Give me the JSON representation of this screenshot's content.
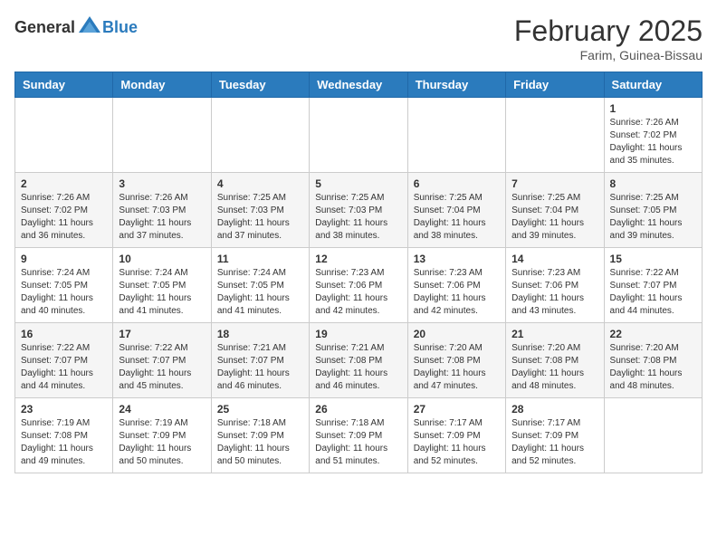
{
  "header": {
    "logo": {
      "general": "General",
      "blue": "Blue"
    },
    "title": "February 2025",
    "location": "Farim, Guinea-Bissau"
  },
  "calendar": {
    "days_of_week": [
      "Sunday",
      "Monday",
      "Tuesday",
      "Wednesday",
      "Thursday",
      "Friday",
      "Saturday"
    ],
    "weeks": [
      [
        {
          "day": "",
          "info": ""
        },
        {
          "day": "",
          "info": ""
        },
        {
          "day": "",
          "info": ""
        },
        {
          "day": "",
          "info": ""
        },
        {
          "day": "",
          "info": ""
        },
        {
          "day": "",
          "info": ""
        },
        {
          "day": "1",
          "info": "Sunrise: 7:26 AM\nSunset: 7:02 PM\nDaylight: 11 hours\nand 35 minutes."
        }
      ],
      [
        {
          "day": "2",
          "info": "Sunrise: 7:26 AM\nSunset: 7:02 PM\nDaylight: 11 hours\nand 36 minutes."
        },
        {
          "day": "3",
          "info": "Sunrise: 7:26 AM\nSunset: 7:03 PM\nDaylight: 11 hours\nand 37 minutes."
        },
        {
          "day": "4",
          "info": "Sunrise: 7:25 AM\nSunset: 7:03 PM\nDaylight: 11 hours\nand 37 minutes."
        },
        {
          "day": "5",
          "info": "Sunrise: 7:25 AM\nSunset: 7:03 PM\nDaylight: 11 hours\nand 38 minutes."
        },
        {
          "day": "6",
          "info": "Sunrise: 7:25 AM\nSunset: 7:04 PM\nDaylight: 11 hours\nand 38 minutes."
        },
        {
          "day": "7",
          "info": "Sunrise: 7:25 AM\nSunset: 7:04 PM\nDaylight: 11 hours\nand 39 minutes."
        },
        {
          "day": "8",
          "info": "Sunrise: 7:25 AM\nSunset: 7:05 PM\nDaylight: 11 hours\nand 39 minutes."
        }
      ],
      [
        {
          "day": "9",
          "info": "Sunrise: 7:24 AM\nSunset: 7:05 PM\nDaylight: 11 hours\nand 40 minutes."
        },
        {
          "day": "10",
          "info": "Sunrise: 7:24 AM\nSunset: 7:05 PM\nDaylight: 11 hours\nand 41 minutes."
        },
        {
          "day": "11",
          "info": "Sunrise: 7:24 AM\nSunset: 7:05 PM\nDaylight: 11 hours\nand 41 minutes."
        },
        {
          "day": "12",
          "info": "Sunrise: 7:23 AM\nSunset: 7:06 PM\nDaylight: 11 hours\nand 42 minutes."
        },
        {
          "day": "13",
          "info": "Sunrise: 7:23 AM\nSunset: 7:06 PM\nDaylight: 11 hours\nand 42 minutes."
        },
        {
          "day": "14",
          "info": "Sunrise: 7:23 AM\nSunset: 7:06 PM\nDaylight: 11 hours\nand 43 minutes."
        },
        {
          "day": "15",
          "info": "Sunrise: 7:22 AM\nSunset: 7:07 PM\nDaylight: 11 hours\nand 44 minutes."
        }
      ],
      [
        {
          "day": "16",
          "info": "Sunrise: 7:22 AM\nSunset: 7:07 PM\nDaylight: 11 hours\nand 44 minutes."
        },
        {
          "day": "17",
          "info": "Sunrise: 7:22 AM\nSunset: 7:07 PM\nDaylight: 11 hours\nand 45 minutes."
        },
        {
          "day": "18",
          "info": "Sunrise: 7:21 AM\nSunset: 7:07 PM\nDaylight: 11 hours\nand 46 minutes."
        },
        {
          "day": "19",
          "info": "Sunrise: 7:21 AM\nSunset: 7:08 PM\nDaylight: 11 hours\nand 46 minutes."
        },
        {
          "day": "20",
          "info": "Sunrise: 7:20 AM\nSunset: 7:08 PM\nDaylight: 11 hours\nand 47 minutes."
        },
        {
          "day": "21",
          "info": "Sunrise: 7:20 AM\nSunset: 7:08 PM\nDaylight: 11 hours\nand 48 minutes."
        },
        {
          "day": "22",
          "info": "Sunrise: 7:20 AM\nSunset: 7:08 PM\nDaylight: 11 hours\nand 48 minutes."
        }
      ],
      [
        {
          "day": "23",
          "info": "Sunrise: 7:19 AM\nSunset: 7:08 PM\nDaylight: 11 hours\nand 49 minutes."
        },
        {
          "day": "24",
          "info": "Sunrise: 7:19 AM\nSunset: 7:09 PM\nDaylight: 11 hours\nand 50 minutes."
        },
        {
          "day": "25",
          "info": "Sunrise: 7:18 AM\nSunset: 7:09 PM\nDaylight: 11 hours\nand 50 minutes."
        },
        {
          "day": "26",
          "info": "Sunrise: 7:18 AM\nSunset: 7:09 PM\nDaylight: 11 hours\nand 51 minutes."
        },
        {
          "day": "27",
          "info": "Sunrise: 7:17 AM\nSunset: 7:09 PM\nDaylight: 11 hours\nand 52 minutes."
        },
        {
          "day": "28",
          "info": "Sunrise: 7:17 AM\nSunset: 7:09 PM\nDaylight: 11 hours\nand 52 minutes."
        },
        {
          "day": "",
          "info": ""
        }
      ]
    ]
  }
}
